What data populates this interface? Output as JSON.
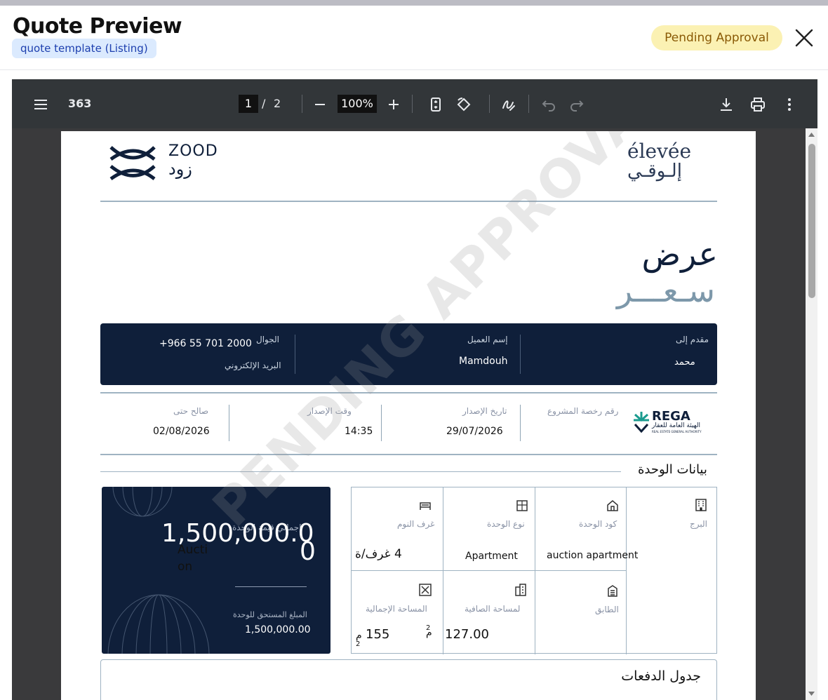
{
  "modal": {
    "title": "Quote Preview",
    "template_chip": "quote template (Listing)",
    "status_badge": "Pending Approval"
  },
  "viewer": {
    "doc_title": "363",
    "page_current": "1",
    "page_sep": "/",
    "page_total": "2",
    "zoom": "100%"
  },
  "doc": {
    "zood_en": "ZOOD",
    "zood_ar": "زود",
    "elevee_en": "élevée",
    "elevee_ar": "إلـوقـي",
    "title_1": "عرض",
    "title_2": "سـعـــر",
    "client": {
      "mobile_label": "الجوال",
      "mobile_value": "+966 55 701 2000",
      "email_label": "البريد الإلكتروني",
      "name_label": "إسم العميل",
      "name_value": "Mamdouh",
      "presented_to_label": "مقدم إلى",
      "presented_to_value": "محمد"
    },
    "dates": {
      "valid_until_label": "صالح حتى",
      "valid_until_value": "02/08/2026",
      "issue_time_label": "وقت الإصدار",
      "issue_time_value": "14:35",
      "issue_date_label": "تاريخ الإصدار",
      "issue_date_value": "29/07/2026",
      "license_label": "رقم رخصة المشروع",
      "rega_en": "REGA",
      "rega_ar": "الهيئة العامة للعقار",
      "rega_sub": "REAL ESTATE GENERAL AUTHORITY"
    },
    "unit_section_title": "بيانات الوحدة",
    "price_card": {
      "big_value": "1,500,000.0",
      "big_value_overflow": "0",
      "total_label": "إجمالي قيمة الوحدة",
      "auction": "Aucti",
      "auction_2": "on",
      "due_label": "المبلغ المستحق للوحدة",
      "due_value": "1,500,000.00"
    },
    "unit_grid": {
      "bedrooms_label": "غرف النوم",
      "bedrooms_value": "4 غرف/ة",
      "unit_type_label": "نوع الوحدة",
      "unit_type_value": "Apartment",
      "unit_code_label": "كود الوحدة",
      "unit_code_value": "auction apartment",
      "tower_label": "البرج",
      "total_area_label": "المساحة الإجمالية",
      "total_area_value": "155",
      "total_area_unit": "م",
      "total_area_sup": "2",
      "net_area_label": "لمساحة الصافية",
      "net_area_value": "127.00",
      "net_area_unit": "م",
      "net_area_sup": "2",
      "floor_label": "الطابق"
    },
    "payments_title": "جدول الدفعات",
    "watermark": "PENDING APPROVAL"
  },
  "colors": {
    "navy": "#0f1f3a",
    "badge_bg": "#fbf1b3",
    "badge_text": "#8a5a06",
    "chip_bg": "#dbeafe",
    "chip_text": "#1e40af",
    "toolbar": "#323639"
  },
  "icons": [
    "menu-icon",
    "zoom-out-icon",
    "zoom-in-icon",
    "fit-page-icon",
    "rotate-icon",
    "annotate-icon",
    "undo-icon",
    "redo-icon",
    "download-icon",
    "print-icon",
    "more-icon",
    "close-icon"
  ]
}
